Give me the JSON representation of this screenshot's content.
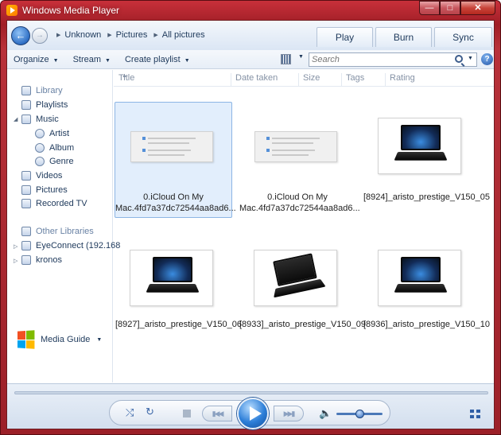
{
  "window": {
    "title": "Windows Media Player",
    "accent_color": "#b8313a"
  },
  "caption_buttons": {
    "minimize": "—",
    "maximize": "□",
    "close": "✕"
  },
  "nav": {
    "back_icon": "back-arrow-icon",
    "forward_icon": "forward-arrow-icon",
    "breadcrumb": [
      "Unknown",
      "Pictures",
      "All pictures"
    ],
    "tabs": [
      "Play",
      "Burn",
      "Sync"
    ]
  },
  "toolbar": {
    "organize": "Organize",
    "stream": "Stream",
    "create_playlist": "Create playlist",
    "search_placeholder": "Search",
    "help": "?"
  },
  "sidebar": {
    "library": "Library",
    "playlists": "Playlists",
    "music": "Music",
    "artist": "Artist",
    "album": "Album",
    "genre": "Genre",
    "videos": "Videos",
    "pictures": "Pictures",
    "recorded_tv": "Recorded TV",
    "other_libraries": "Other Libraries",
    "eyeconnect": "EyeConnect (192.168",
    "kronos": "kronos",
    "media_guide": "Media Guide"
  },
  "columns": [
    "Title",
    "Date taken",
    "Size",
    "Tags",
    "Rating"
  ],
  "items": [
    {
      "caption_line1": "0.iCloud On My",
      "caption_line2": "Mac.4fd7a37dc72544aa8ad6...",
      "kind": "screenshot",
      "selected": true
    },
    {
      "caption_line1": "0.iCloud On My",
      "caption_line2": "Mac.4fd7a37dc72544aa8ad6...",
      "kind": "screenshot",
      "selected": false
    },
    {
      "caption_line1": "[8924]_aristo_prestige_V150_05",
      "caption_line2": "",
      "kind": "laptop",
      "selected": false
    },
    {
      "caption_line1": "[8927]_aristo_prestige_V150_06",
      "caption_line2": "",
      "kind": "laptop",
      "selected": false
    },
    {
      "caption_line1": "[8933]_aristo_prestige_V150_09",
      "caption_line2": "",
      "kind": "laptop",
      "selected": false
    },
    {
      "caption_line1": "[8936]_aristo_prestige_V150_10",
      "caption_line2": "",
      "kind": "laptop",
      "selected": false
    }
  ],
  "player": {
    "shuffle_icon": "shuffle-icon",
    "repeat_icon": "repeat-icon",
    "volume_level": 0.5
  }
}
